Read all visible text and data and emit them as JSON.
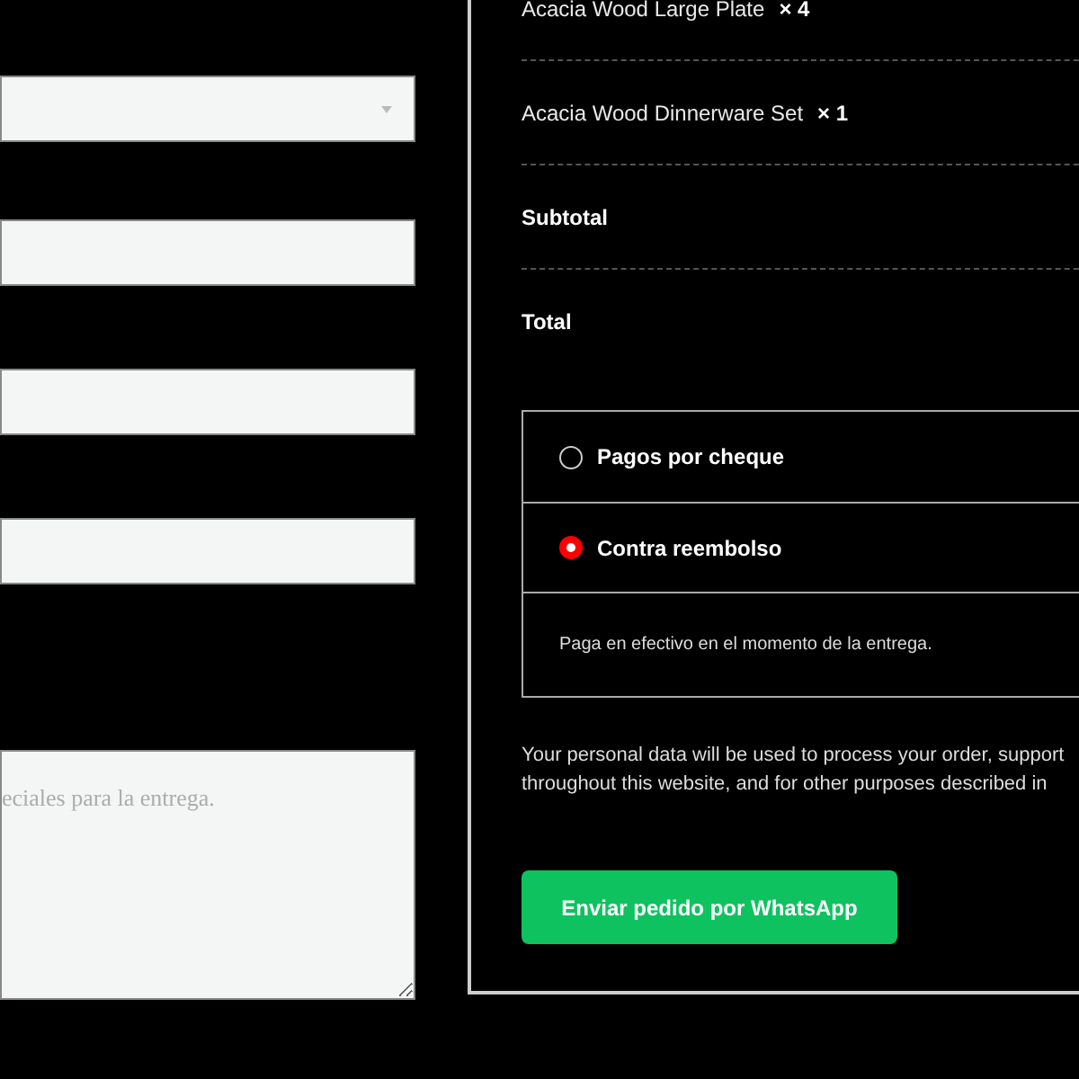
{
  "form_fields": [
    {
      "kind": "select"
    },
    {
      "kind": "text"
    },
    {
      "kind": "text"
    },
    {
      "kind": "text"
    },
    {
      "kind": "textarea",
      "placeholder": "eciales para la entrega."
    }
  ],
  "order_items": [
    {
      "name": "Acacia Wood Large Plate",
      "quantity": "× 4"
    },
    {
      "name": "Acacia Wood Dinnerware Set",
      "quantity": "× 1"
    }
  ],
  "totals": [
    {
      "label": "Subtotal"
    },
    {
      "label": "Total"
    }
  ],
  "payment_methods": [
    {
      "label": "Pagos por cheque",
      "selected": false
    },
    {
      "label": "Contra reembolso",
      "selected": true,
      "description": "Paga en efectivo en el momento de la entrega."
    }
  ],
  "privacy_text": [
    "Your personal data will be used to process your order, support",
    "throughout this website, and for other purposes described in"
  ],
  "submit_button": "Enviar pedido por WhatsApp"
}
